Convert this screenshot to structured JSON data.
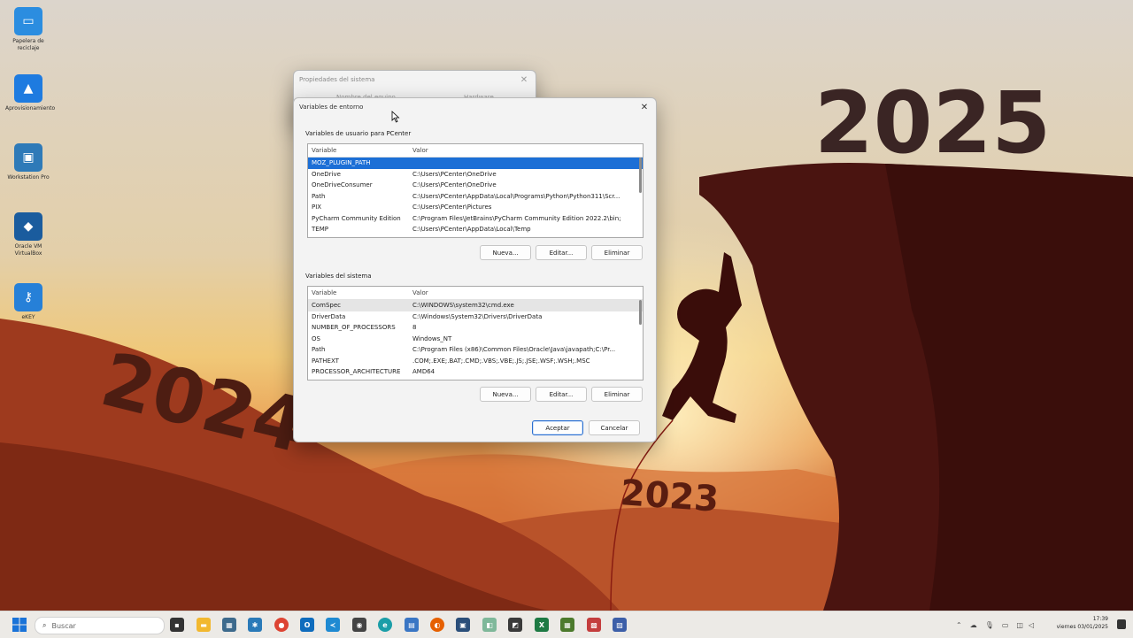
{
  "desktop": {
    "icons": [
      {
        "label": "Papelera de reciclaje",
        "icon": "recycle-bin-icon",
        "color": "#2b8de0"
      },
      {
        "label": "Aprovisionamiento",
        "icon": "app-icon",
        "color": "#1e7be0"
      },
      {
        "label": "Workstation Pro",
        "icon": "vmware-icon",
        "color": "#2e7ab8"
      },
      {
        "label": "Oracle VM VirtualBox",
        "icon": "virtualbox-icon",
        "color": "#1a5c9e"
      },
      {
        "label": "eKEY",
        "icon": "key-icon",
        "color": "#2680d8"
      }
    ],
    "wallpaper": {
      "year_top": "2025",
      "year_left": "2024",
      "year_bottom": "2023"
    }
  },
  "back_dialog": {
    "title": "Propiedades del sistema",
    "tab1": "Nombre del equipo",
    "tab2": "Hardware"
  },
  "env_dialog": {
    "title": "Variables de entorno",
    "user_group_label": "Variables de usuario para PCenter",
    "sys_group_label": "Variables del sistema",
    "col_variable": "Variable",
    "col_value": "Valor",
    "user_rows": [
      {
        "variable": "MOZ_PLUGIN_PATH",
        "value": ""
      },
      {
        "variable": "OneDrive",
        "value": "C:\\Users\\PCenter\\OneDrive"
      },
      {
        "variable": "OneDriveConsumer",
        "value": "C:\\Users\\PCenter\\OneDrive"
      },
      {
        "variable": "Path",
        "value": "C:\\Users\\PCenter\\AppData\\Local\\Programs\\Python\\Python311\\Scr..."
      },
      {
        "variable": "PIX",
        "value": "C:\\Users\\PCenter\\Pictures"
      },
      {
        "variable": "PyCharm Community Edition",
        "value": "C:\\Program Files\\JetBrains\\PyCharm Community Edition 2022.2\\bin;"
      },
      {
        "variable": "TEMP",
        "value": "C:\\Users\\PCenter\\AppData\\Local\\Temp"
      }
    ],
    "sys_rows": [
      {
        "variable": "ComSpec",
        "value": "C:\\WINDOWS\\system32\\cmd.exe"
      },
      {
        "variable": "DriverData",
        "value": "C:\\Windows\\System32\\Drivers\\DriverData"
      },
      {
        "variable": "NUMBER_OF_PROCESSORS",
        "value": "8"
      },
      {
        "variable": "OS",
        "value": "Windows_NT"
      },
      {
        "variable": "Path",
        "value": "C:\\Program Files (x86)\\Common Files\\Oracle\\Java\\javapath;C:\\Pr..."
      },
      {
        "variable": "PATHEXT",
        "value": ".COM;.EXE;.BAT;.CMD;.VBS;.VBE;.JS;.JSE;.WSF;.WSH;.MSC"
      },
      {
        "variable": "PROCESSOR_ARCHITECTURE",
        "value": "AMD64"
      }
    ],
    "btn_new": "Nueva...",
    "btn_edit": "Editar...",
    "btn_delete": "Eliminar",
    "btn_accept": "Aceptar",
    "btn_cancel": "Cancelar"
  },
  "taskbar": {
    "search_placeholder": "Buscar",
    "clock_time": "17:39",
    "clock_date": "viernes 03/01/2025"
  }
}
